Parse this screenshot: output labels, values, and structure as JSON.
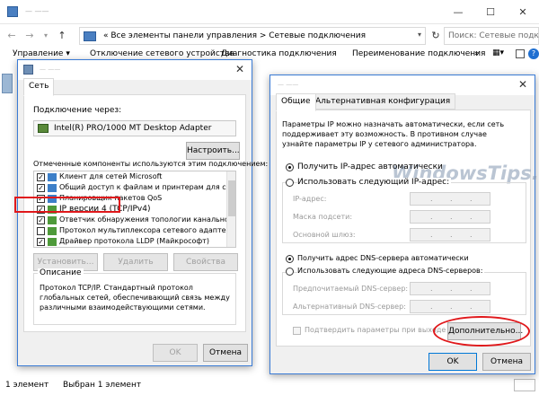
{
  "explorer": {
    "title": "— ——",
    "address_text": "«  Все элементы панели управления  >  Сетевые подключения",
    "search_placeholder": "Поиск: Сетевые подклю",
    "toolbar": {
      "organize": "Управление ▾",
      "disconnect": "Отключение сетевого устройства",
      "diagnose": "Диагностика подключения",
      "rename": "Переименование подключения",
      "more": "»"
    },
    "status": {
      "count": "1 элемент",
      "selected": "Выбран 1 элемент"
    }
  },
  "props": {
    "title": "— ——",
    "tab": "Сеть",
    "connect_using_label": "Подключение через:",
    "adapter": "Intel(R) PRO/1000 MT Desktop Adapter",
    "configure_button": "Настроить...",
    "components_label": "Отмеченные компоненты используются этим подключением:",
    "components": [
      {
        "label": "Клиент для сетей Microsoft",
        "checked": true
      },
      {
        "label": "Общий доступ к файлам и принтерам для сетей M",
        "checked": true
      },
      {
        "label": "Планировщик пакетов QoS",
        "checked": true
      },
      {
        "label": "IP версии 4 (TCP/IPv4)",
        "checked": true
      },
      {
        "label": "Ответчик обнаружения топологии канального уров",
        "checked": true
      },
      {
        "label": "Протокол мультиплексора сетевого адаптера (Ма",
        "checked": false
      },
      {
        "label": "Драйвер протокола LLDP (Майкрософт)",
        "checked": true
      }
    ],
    "install_button": "Установить...",
    "remove_button": "Удалить",
    "properties_button": "Свойства",
    "description_title": "Описание",
    "description_text": "Протокол TCP/IP. Стандартный протокол глобальных сетей, обеспечивающий связь между различными взаимодействующими сетями.",
    "ok_button": "OK",
    "cancel_button": "Отмена"
  },
  "ipv4": {
    "title": "— ——",
    "tab_general": "Общие",
    "tab_alternate": "Альтернативная конфигурация",
    "intro_text": "Параметры IP можно назначать автоматически, если сеть поддерживает эту возможность. В противном случае узнайте параметры IP у сетевого администратора.",
    "watermark": "WindowsTips.Ru",
    "auto_ip": "Получить IP-адрес автоматически",
    "manual_ip": "Использовать следующий IP-адрес:",
    "ip_address_label": "IP-адрес:",
    "subnet_label": "Маска подсети:",
    "gateway_label": "Основной шлюз:",
    "auto_dns": "Получить адрес DNS-сервера автоматически",
    "manual_dns": "Использовать следующие адреса DNS-серверов:",
    "preferred_dns_label": "Предпочитаемый DNS-сервер:",
    "alternate_dns_label": "Альтернативный DNS-сервер:",
    "validate_label": "Подтвердить параметры при выходе",
    "advanced_button": "Дополнительно...",
    "ok_button": "OK",
    "cancel_button": "Отмена"
  },
  "colors": {
    "highlight_red": "#e0181b",
    "accent_blue": "#0078d7",
    "dialog_bg": "#f0f0f0"
  }
}
